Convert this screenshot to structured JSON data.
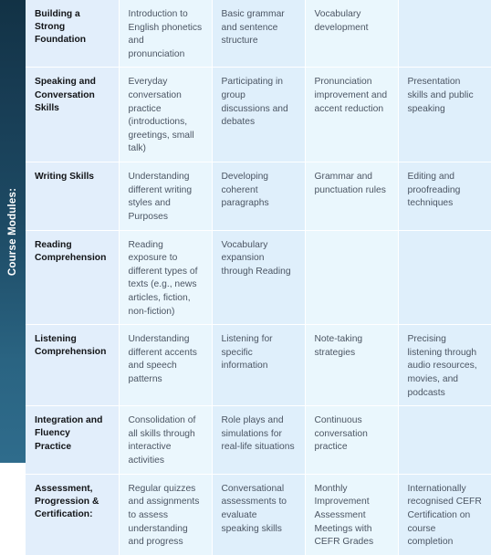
{
  "rail": {
    "label": "Course Modules:",
    "background_top": "#123245",
    "background_bottom": "#2f6c8c",
    "text_color": "#ffffff"
  },
  "theme": {
    "column_tint_light": "#eaf7fd",
    "column_tint_dark": "#dfeffb",
    "module_column_tint": "#e2eefb",
    "body_text_color": "#4b5563",
    "module_text_color": "#121417",
    "gridline_color": "#ffffff"
  },
  "table": {
    "column_count": 5,
    "row_count": 7,
    "rows": [
      {
        "module": "Building a Strong Foundation",
        "cells": [
          "Introduction to English phonetics and pronunciation",
          "Basic grammar and sentence structure",
          "Vocabulary development",
          ""
        ]
      },
      {
        "module": "Speaking and Conversation Skills",
        "cells": [
          "Everyday conversation practice (introductions, greetings, small talk)",
          "Participating in group discussions and debates",
          "Pronunciation improvement and accent reduction",
          "Presentation skills and public speaking"
        ]
      },
      {
        "module": "Writing Skills",
        "cells": [
          "Understanding different writing styles and Purposes",
          "Developing coherent paragraphs",
          "Grammar and punctuation rules",
          "Editing and proofreading techniques"
        ]
      },
      {
        "module": "Reading Comprehension",
        "cells": [
          "Reading exposure to different types of texts (e.g., news articles, fiction, non-fiction)",
          "Vocabulary expansion through Reading",
          "",
          ""
        ]
      },
      {
        "module": "Listening Comprehension",
        "cells": [
          "Understanding different accents and speech patterns",
          "Listening for specific information",
          "Note-taking strategies",
          "Precising listening through audio resources, movies, and podcasts"
        ]
      },
      {
        "module": "Integration and Fluency Practice",
        "cells": [
          "Consolidation of all skills through interactive activities",
          "Role plays and simulations for real-life situations",
          "Continuous conversation practice",
          ""
        ]
      },
      {
        "module": "Assessment, Progression & Certification:",
        "cells": [
          "Regular quizzes and assignments to assess understanding and progress",
          "Conversational assessments to evaluate speaking skills",
          "Monthly Improvement Assessment Meetings with CEFR Grades",
          "Internationally recognised CEFR Certification on course completion"
        ]
      }
    ]
  }
}
